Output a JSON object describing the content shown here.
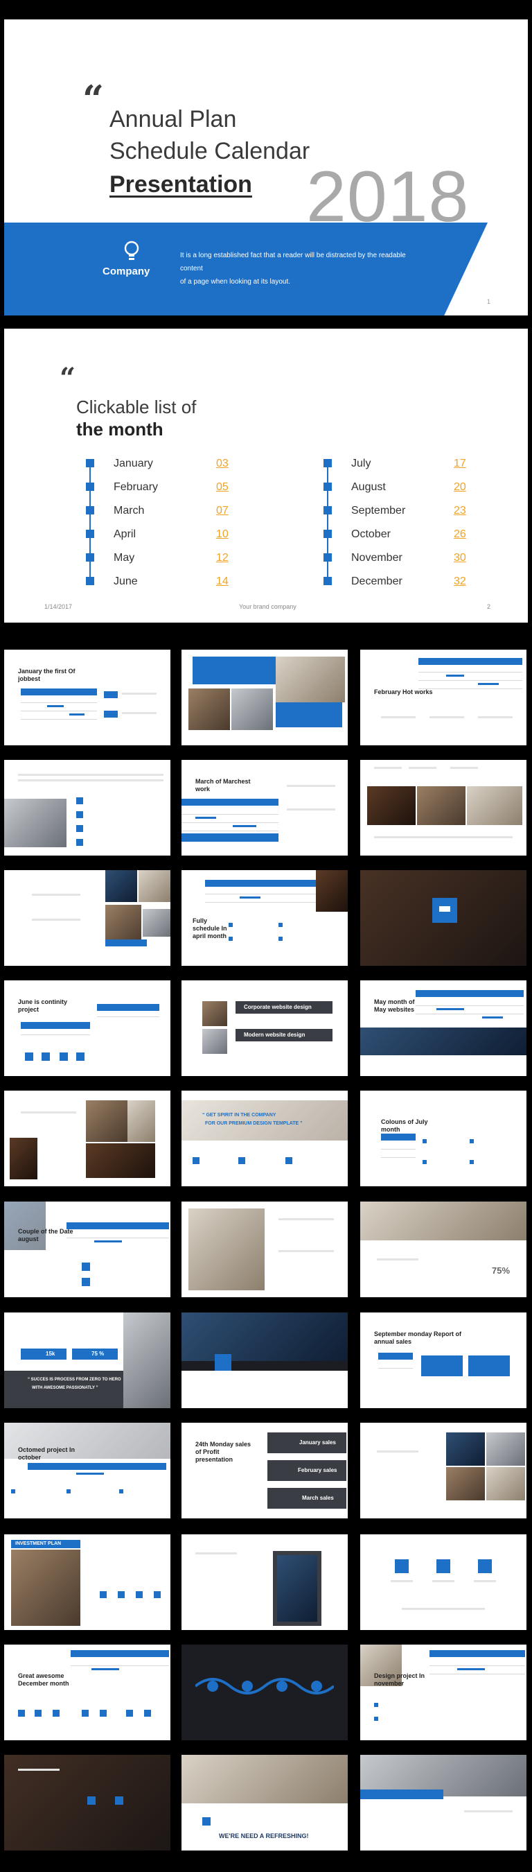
{
  "slide1": {
    "quote_mark": "“",
    "title_lines": [
      "Annual Plan",
      "Schedule Calendar",
      "Presentation"
    ],
    "year": "2018",
    "company": "Company",
    "description_line1": "It is a long established fact that a reader will be distracted by the readable content",
    "description_line2": "of a page when looking at its layout.",
    "page_number": "1"
  },
  "slide2": {
    "quote_mark": "“",
    "title_line1": "Clickable list of",
    "title_line2": "the month",
    "months": [
      {
        "name": "January",
        "page": "03"
      },
      {
        "name": "February",
        "page": "05"
      },
      {
        "name": "March",
        "page": "07"
      },
      {
        "name": "April",
        "page": "10"
      },
      {
        "name": "May",
        "page": "12"
      },
      {
        "name": "June",
        "page": "14"
      },
      {
        "name": "July",
        "page": "17"
      },
      {
        "name": "August",
        "page": "20"
      },
      {
        "name": "September",
        "page": "23"
      },
      {
        "name": "October",
        "page": "26"
      },
      {
        "name": "November",
        "page": "30"
      },
      {
        "name": "December",
        "page": "32"
      }
    ],
    "footer_date": "1/14/2017",
    "footer_brand": "Your brand company",
    "page_number": "2"
  },
  "thumbnails": {
    "t1": "January the first Of jobbest",
    "t3": "February Hot works",
    "t5": "March of Marchest work",
    "t8": "Fully schedule In april month",
    "t10": "June is continity project",
    "t11a": "Corporate website design",
    "t11b": "Modern website design",
    "t12": "May month of May websites",
    "t14a": "“ GET SPIRIT IN THE COMPANY",
    "t14b": "FOR OUR PREMIUM DESIGN TEMPLATE ”",
    "t15": "Colouns of July month",
    "t16": "Couple of the Date august",
    "t18_pct": "75%",
    "t19_num": "15k",
    "t19_pct": "75 %",
    "t19_q1": "“ SUCCES IS PROCESS FROM ZERO TO HERO",
    "t19_q2": "WITH AWESOME PASSIONATLY ”",
    "t21": "September monday Report of annual sales",
    "t22": "Octomed project In october",
    "t23": "24th Monday sales of Profit presentation",
    "t23a": "January sales",
    "t23b": "February sales",
    "t23c": "March sales",
    "t25": "INVESTMENT PLAN",
    "t28": "Great awesome December month",
    "t30": "Design project In november",
    "t32": "WE'RE NEED A REFRESHING!"
  },
  "colors": {
    "accent": "#1e6fc6",
    "highlight": "#f0a325",
    "year_gray": "#a9a9a9"
  }
}
